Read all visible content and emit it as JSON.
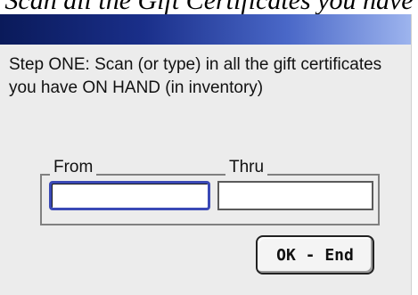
{
  "background_caption": "Scan all the Gift Certificates you have",
  "dialog": {
    "prompt": "Step ONE: Scan (or type) in all the gift certificates you have ON HAND (in inventory)",
    "range": {
      "from_label": "From",
      "thru_label": "Thru",
      "from_value": "",
      "thru_value": ""
    },
    "ok_button_label": "OK - End"
  },
  "colors": {
    "titlebar_start": "#0a1a5a",
    "titlebar_end": "#9db4ee",
    "focus_border": "#3a49b6",
    "window_bg": "#ececec"
  }
}
